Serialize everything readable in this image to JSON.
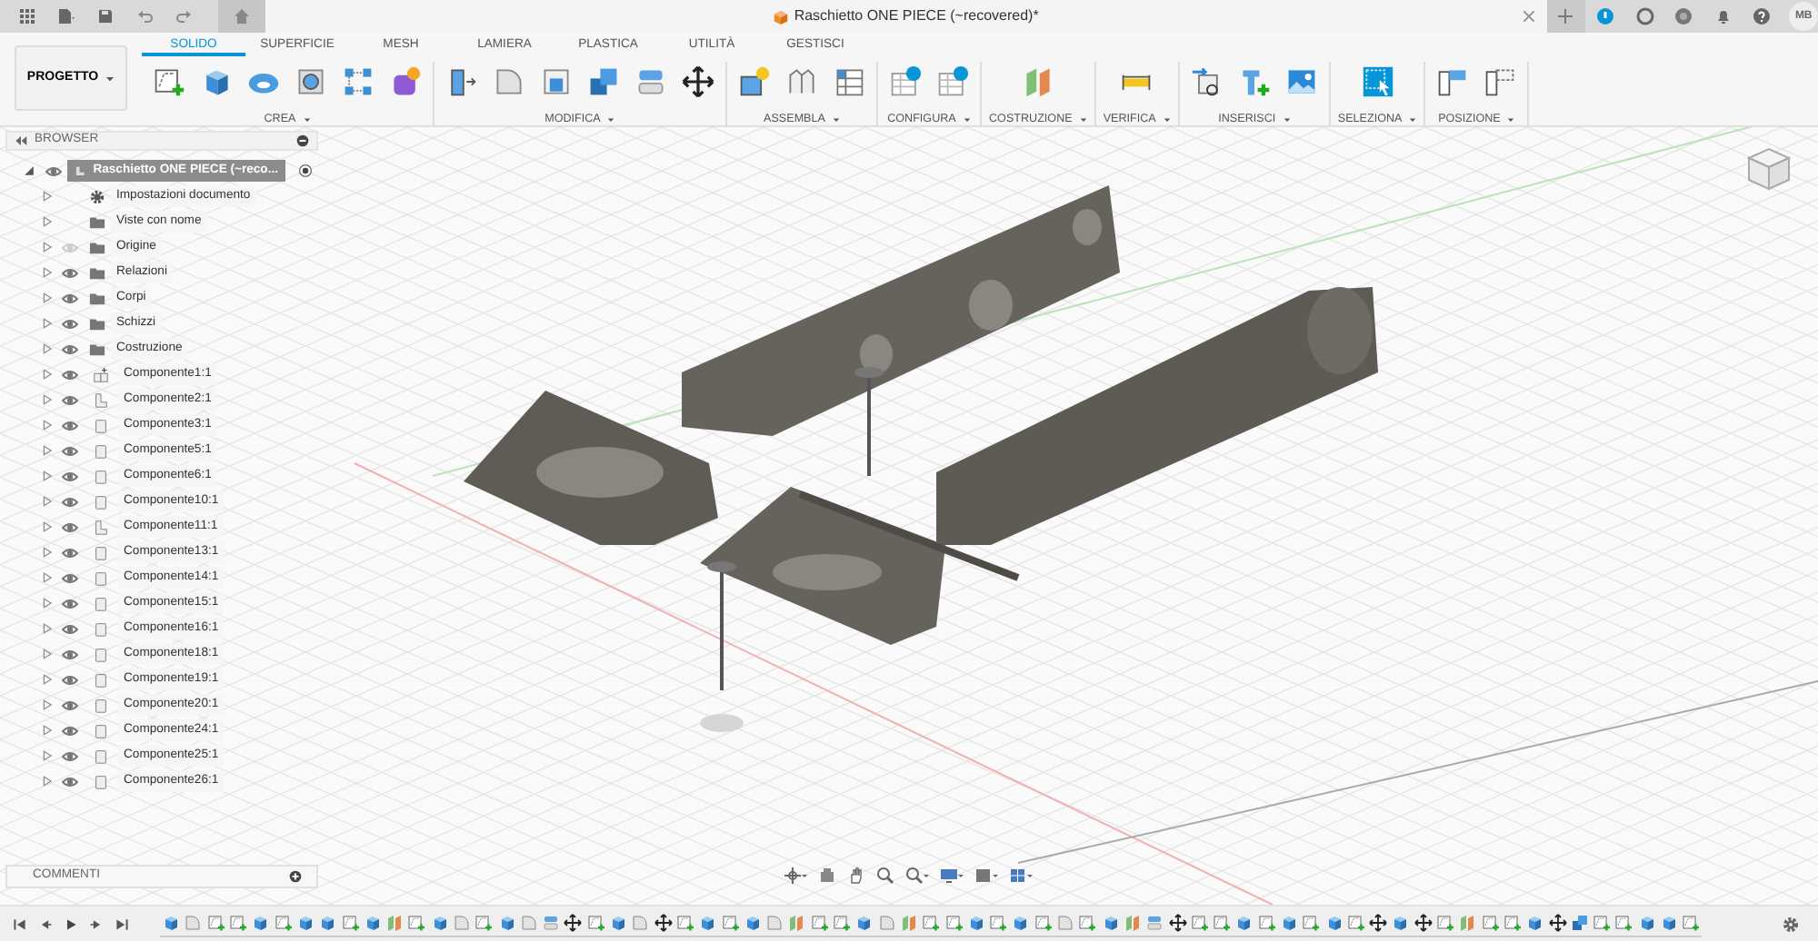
{
  "title_bar": {
    "document_title": "Raschietto ONE PIECE (~recovered)*",
    "avatar": "MB"
  },
  "ribbon": {
    "workspace": "PROGETTO",
    "tabs": [
      {
        "label": "SOLIDO",
        "selected": true
      },
      {
        "label": "SUPERFICIE",
        "selected": false
      },
      {
        "label": "MESH",
        "selected": false
      },
      {
        "label": "LAMIERA",
        "selected": false
      },
      {
        "label": "PLASTICA",
        "selected": false
      },
      {
        "label": "UTILITÀ",
        "selected": false
      },
      {
        "label": "GESTISCI",
        "selected": false
      }
    ],
    "groups": [
      {
        "label": "CREA",
        "tools": [
          {
            "kind": "sketch"
          },
          {
            "kind": "box"
          },
          {
            "kind": "revolve"
          },
          {
            "kind": "hole"
          },
          {
            "kind": "pattern"
          },
          {
            "kind": "form"
          }
        ]
      },
      {
        "label": "MODIFICA",
        "tools": [
          {
            "kind": "pressfit"
          },
          {
            "kind": "fillet"
          },
          {
            "kind": "shell"
          },
          {
            "kind": "combine"
          },
          {
            "kind": "offset"
          },
          {
            "kind": "move"
          }
        ]
      },
      {
        "label": "ASSEMBLA",
        "tools": [
          {
            "kind": "component"
          },
          {
            "kind": "joint"
          },
          {
            "kind": "table"
          }
        ]
      },
      {
        "label": "CONFIGURA",
        "tools": [
          {
            "kind": "configure"
          },
          {
            "kind": "configure"
          }
        ]
      },
      {
        "label": "COSTRUZIONE",
        "tools": [
          {
            "kind": "plane"
          }
        ]
      },
      {
        "label": "VERIFICA",
        "tools": [
          {
            "kind": "measure"
          }
        ]
      },
      {
        "label": "INSERISCI",
        "tools": [
          {
            "kind": "insert"
          },
          {
            "kind": "insertcomp"
          },
          {
            "kind": "image"
          }
        ]
      },
      {
        "label": "SELEZIONA",
        "tools": [
          {
            "kind": "select"
          }
        ]
      },
      {
        "label": "POSIZIONE",
        "tools": [
          {
            "kind": "posfill"
          },
          {
            "kind": "posframe"
          }
        ]
      }
    ]
  },
  "browser": {
    "title": "BROWSER",
    "root": {
      "label": "Raschietto ONE PIECE (~reco...",
      "visible": true,
      "expanded": true,
      "active": true
    },
    "items": [
      {
        "label": "Impostazioni documento",
        "kind": "settings"
      },
      {
        "label": "Viste con nome",
        "kind": "folder"
      },
      {
        "label": "Origine",
        "kind": "folder",
        "visible": false
      },
      {
        "label": "Relazioni",
        "kind": "folder",
        "visible": true
      },
      {
        "label": "Corpi",
        "kind": "folder",
        "visible": true
      },
      {
        "label": "Schizzi",
        "kind": "folder",
        "visible": true
      },
      {
        "label": "Costruzione",
        "kind": "folder",
        "visible": true
      },
      {
        "label": "Componente1:1",
        "kind": "assembly",
        "visible": true
      },
      {
        "label": "Componente2:1",
        "kind": "part",
        "visible": true
      },
      {
        "label": "Componente3:1",
        "kind": "body",
        "visible": true
      },
      {
        "label": "Componente5:1",
        "kind": "body",
        "visible": true
      },
      {
        "label": "Componente6:1",
        "kind": "body",
        "visible": true
      },
      {
        "label": "Componente10:1",
        "kind": "body",
        "visible": true
      },
      {
        "label": "Componente11:1",
        "kind": "part",
        "visible": true
      },
      {
        "label": "Componente13:1",
        "kind": "body",
        "visible": true
      },
      {
        "label": "Componente14:1",
        "kind": "body",
        "visible": true
      },
      {
        "label": "Componente15:1",
        "kind": "body",
        "visible": true
      },
      {
        "label": "Componente16:1",
        "kind": "body",
        "visible": true
      },
      {
        "label": "Componente18:1",
        "kind": "body",
        "visible": true
      },
      {
        "label": "Componente19:1",
        "kind": "body",
        "visible": true
      },
      {
        "label": "Componente20:1",
        "kind": "body",
        "visible": true
      },
      {
        "label": "Componente24:1",
        "kind": "body",
        "visible": true
      },
      {
        "label": "Componente25:1",
        "kind": "body",
        "visible": true
      },
      {
        "label": "Componente26:1",
        "kind": "body",
        "visible": true
      }
    ]
  },
  "comments": {
    "title": "COMMENTI"
  },
  "timeline": [
    {
      "kind": "box"
    },
    {
      "kind": "fillet"
    },
    {
      "kind": "sketch"
    },
    {
      "kind": "sketch"
    },
    {
      "kind": "box"
    },
    {
      "kind": "sketch"
    },
    {
      "kind": "box"
    },
    {
      "kind": "box"
    },
    {
      "kind": "sketch"
    },
    {
      "kind": "box"
    },
    {
      "kind": "plane"
    },
    {
      "kind": "sketch"
    },
    {
      "kind": "box"
    },
    {
      "kind": "fillet"
    },
    {
      "kind": "sketch"
    },
    {
      "kind": "box"
    },
    {
      "kind": "fillet"
    },
    {
      "kind": "offset"
    },
    {
      "kind": "move"
    },
    {
      "kind": "sketch"
    },
    {
      "kind": "box"
    },
    {
      "kind": "fillet"
    },
    {
      "kind": "move"
    },
    {
      "kind": "sketch"
    },
    {
      "kind": "box"
    },
    {
      "kind": "sketch"
    },
    {
      "kind": "box"
    },
    {
      "kind": "fillet"
    },
    {
      "kind": "plane"
    },
    {
      "kind": "sketch"
    },
    {
      "kind": "sketch"
    },
    {
      "kind": "box"
    },
    {
      "kind": "fillet"
    },
    {
      "kind": "plane"
    },
    {
      "kind": "sketch"
    },
    {
      "kind": "sketch"
    },
    {
      "kind": "box"
    },
    {
      "kind": "sketch"
    },
    {
      "kind": "box"
    },
    {
      "kind": "sketch"
    },
    {
      "kind": "fillet"
    },
    {
      "kind": "sketch"
    },
    {
      "kind": "box"
    },
    {
      "kind": "plane"
    },
    {
      "kind": "offset"
    },
    {
      "kind": "move"
    },
    {
      "kind": "sketch"
    },
    {
      "kind": "sketch"
    },
    {
      "kind": "box"
    },
    {
      "kind": "sketch"
    },
    {
      "kind": "box"
    },
    {
      "kind": "sketch"
    },
    {
      "kind": "box"
    },
    {
      "kind": "sketch"
    },
    {
      "kind": "move"
    },
    {
      "kind": "box"
    },
    {
      "kind": "move"
    },
    {
      "kind": "sketch"
    },
    {
      "kind": "plane"
    },
    {
      "kind": "sketch"
    },
    {
      "kind": "sketch"
    },
    {
      "kind": "box"
    },
    {
      "kind": "move"
    },
    {
      "kind": "combine"
    },
    {
      "kind": "sketch"
    },
    {
      "kind": "sketch"
    },
    {
      "kind": "box"
    },
    {
      "kind": "box"
    },
    {
      "kind": "sketch"
    }
  ]
}
